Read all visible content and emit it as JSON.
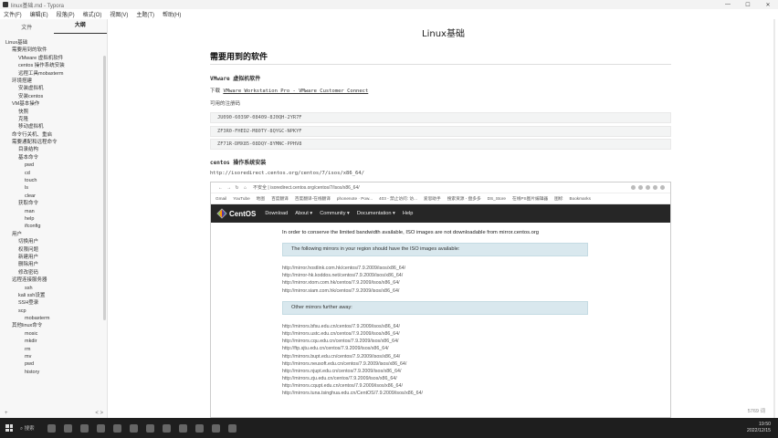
{
  "window": {
    "title": "linux基础.md - Typora",
    "controls": [
      "—",
      "☐",
      "✕"
    ]
  },
  "menu": [
    "文件(F)",
    "编辑(E)",
    "段落(P)",
    "格式(O)",
    "视图(V)",
    "主题(T)",
    "帮助(H)"
  ],
  "sidebar": {
    "tabs": [
      "文件",
      "大纲"
    ],
    "active_tab": "大纲",
    "outline": [
      "Linux基础",
      "需要用到的软件",
      "VMware 虚拟机软件",
      "centos 操作系统安装",
      "远程工具mobaxterm",
      "环境搭建",
      "安装虚拟机",
      "安装centos",
      "VM基本操作",
      "快照",
      "克隆",
      "移动虚拟机",
      "命令行关机、重启",
      "需要通配和远程命令",
      "目录结构",
      "基本命令",
      "pwd",
      "cd",
      "touch",
      "ls",
      "clear",
      "获取命令",
      "man",
      "help",
      "ifconfig",
      "用户",
      "切换用户",
      "权限问题",
      "新建用户",
      "删除用户",
      "修改密码",
      "远程连接服务器",
      "ssh",
      "kali ssh设置",
      "SSH登录",
      "scp",
      "mobaxterm",
      "其他linux命令",
      "mosic",
      "mkdir",
      "rm",
      "mv",
      "pwd",
      "history"
    ],
    "bottom_left": "+",
    "bottom_right": "< >"
  },
  "document": {
    "title": "Linux基础",
    "h2": "需要用到的软件",
    "vmware_heading": "VMware 虚拟机软件",
    "download_prefix": "下载",
    "download_link": "VMware Workstation Pro - VMware Customer Connect",
    "license_label": "可用的注册码",
    "keys": [
      "JU090-6039P-08409-8J0QH-2YR7F",
      "ZF3R0-FHED2-M80TY-8QYGC-NPKYF",
      "ZF71R-DMX85-08DQY-8YMNC-PPHV8"
    ],
    "centos_heading": "centos 操作系统安装",
    "centos_url": "http://isoredirect.centos.org/centos/7/isos/x86_64/",
    "word_count": "5769 词"
  },
  "browser": {
    "url": "不安全 | isoredirect.centos.org/centos/7/isos/x86_64/",
    "bookmarks": [
      "Gmail",
      "YouTube",
      "地图",
      "百度翻译",
      "百度翻译-在线翻译",
      "phonenote · Pow...",
      "403 - 禁止访问: 访...",
      "爱思助手",
      "搜索资源 - 盘多多",
      "DS_Store",
      "在线PS图片编辑器",
      "图标",
      "Bookmarks"
    ],
    "brand": "CentOS",
    "nav": [
      "Download",
      "About ▾",
      "Community ▾",
      "Documentation ▾",
      "Help"
    ],
    "notice": "In order to conserve the limited bandwidth available, ISO images are not downloadable from mirror.centos.org",
    "panel1": "The following mirrors in your region should have the ISO images available:",
    "mirrors1": [
      "http://mirror.hostlink.com.hk/centos/7.9.2009/isos/x86_64/",
      "http://mirror-hk.koddos.net/centos/7.9.2009/isos/x86_64/",
      "http://mirror.xtom.com.hk/centos/7.9.2009/isos/x86_64/",
      "http://mirror.siam.com.hk/centos/7.9.2009/isos/x86_64/"
    ],
    "panel2": "Other mirrors further away:",
    "mirrors2": [
      "http://mirrors.bfsu.edu.cn/centos/7.9.2009/isos/x86_64/",
      "http://mirrors.ustc.edu.cn/centos/7.9.2009/isos/x86_64/",
      "http://mirrors.cqu.edu.cn/centos/7.9.2009/isos/x86_64/",
      "http://ftp.sjtu.edu.cn/centos/7.9.2009/isos/x86_64/",
      "http://mirrors.bupt.edu.cn/centos/7.9.2009/isos/x86_64/",
      "http://mirrors.neusoft.edu.cn/centos/7.9.2009/isos/x86_64/",
      "http://mirrors.njupt.edu.cn/centos/7.9.2009/isos/x86_64/",
      "http://mirrors.zju.edu.cn/centos/7.9.2009/isos/x86_64/",
      "http://mirrors.cqupt.edu.cn/centos/7.9.2009/isos/x86_64/",
      "http://mirrors.tuna.tsinghua.edu.cn/CentOS/7.9.2009/isos/x86_64/"
    ]
  },
  "taskbar": {
    "search_label": "搜索",
    "time": "19:50",
    "date": "2022/12/15"
  }
}
